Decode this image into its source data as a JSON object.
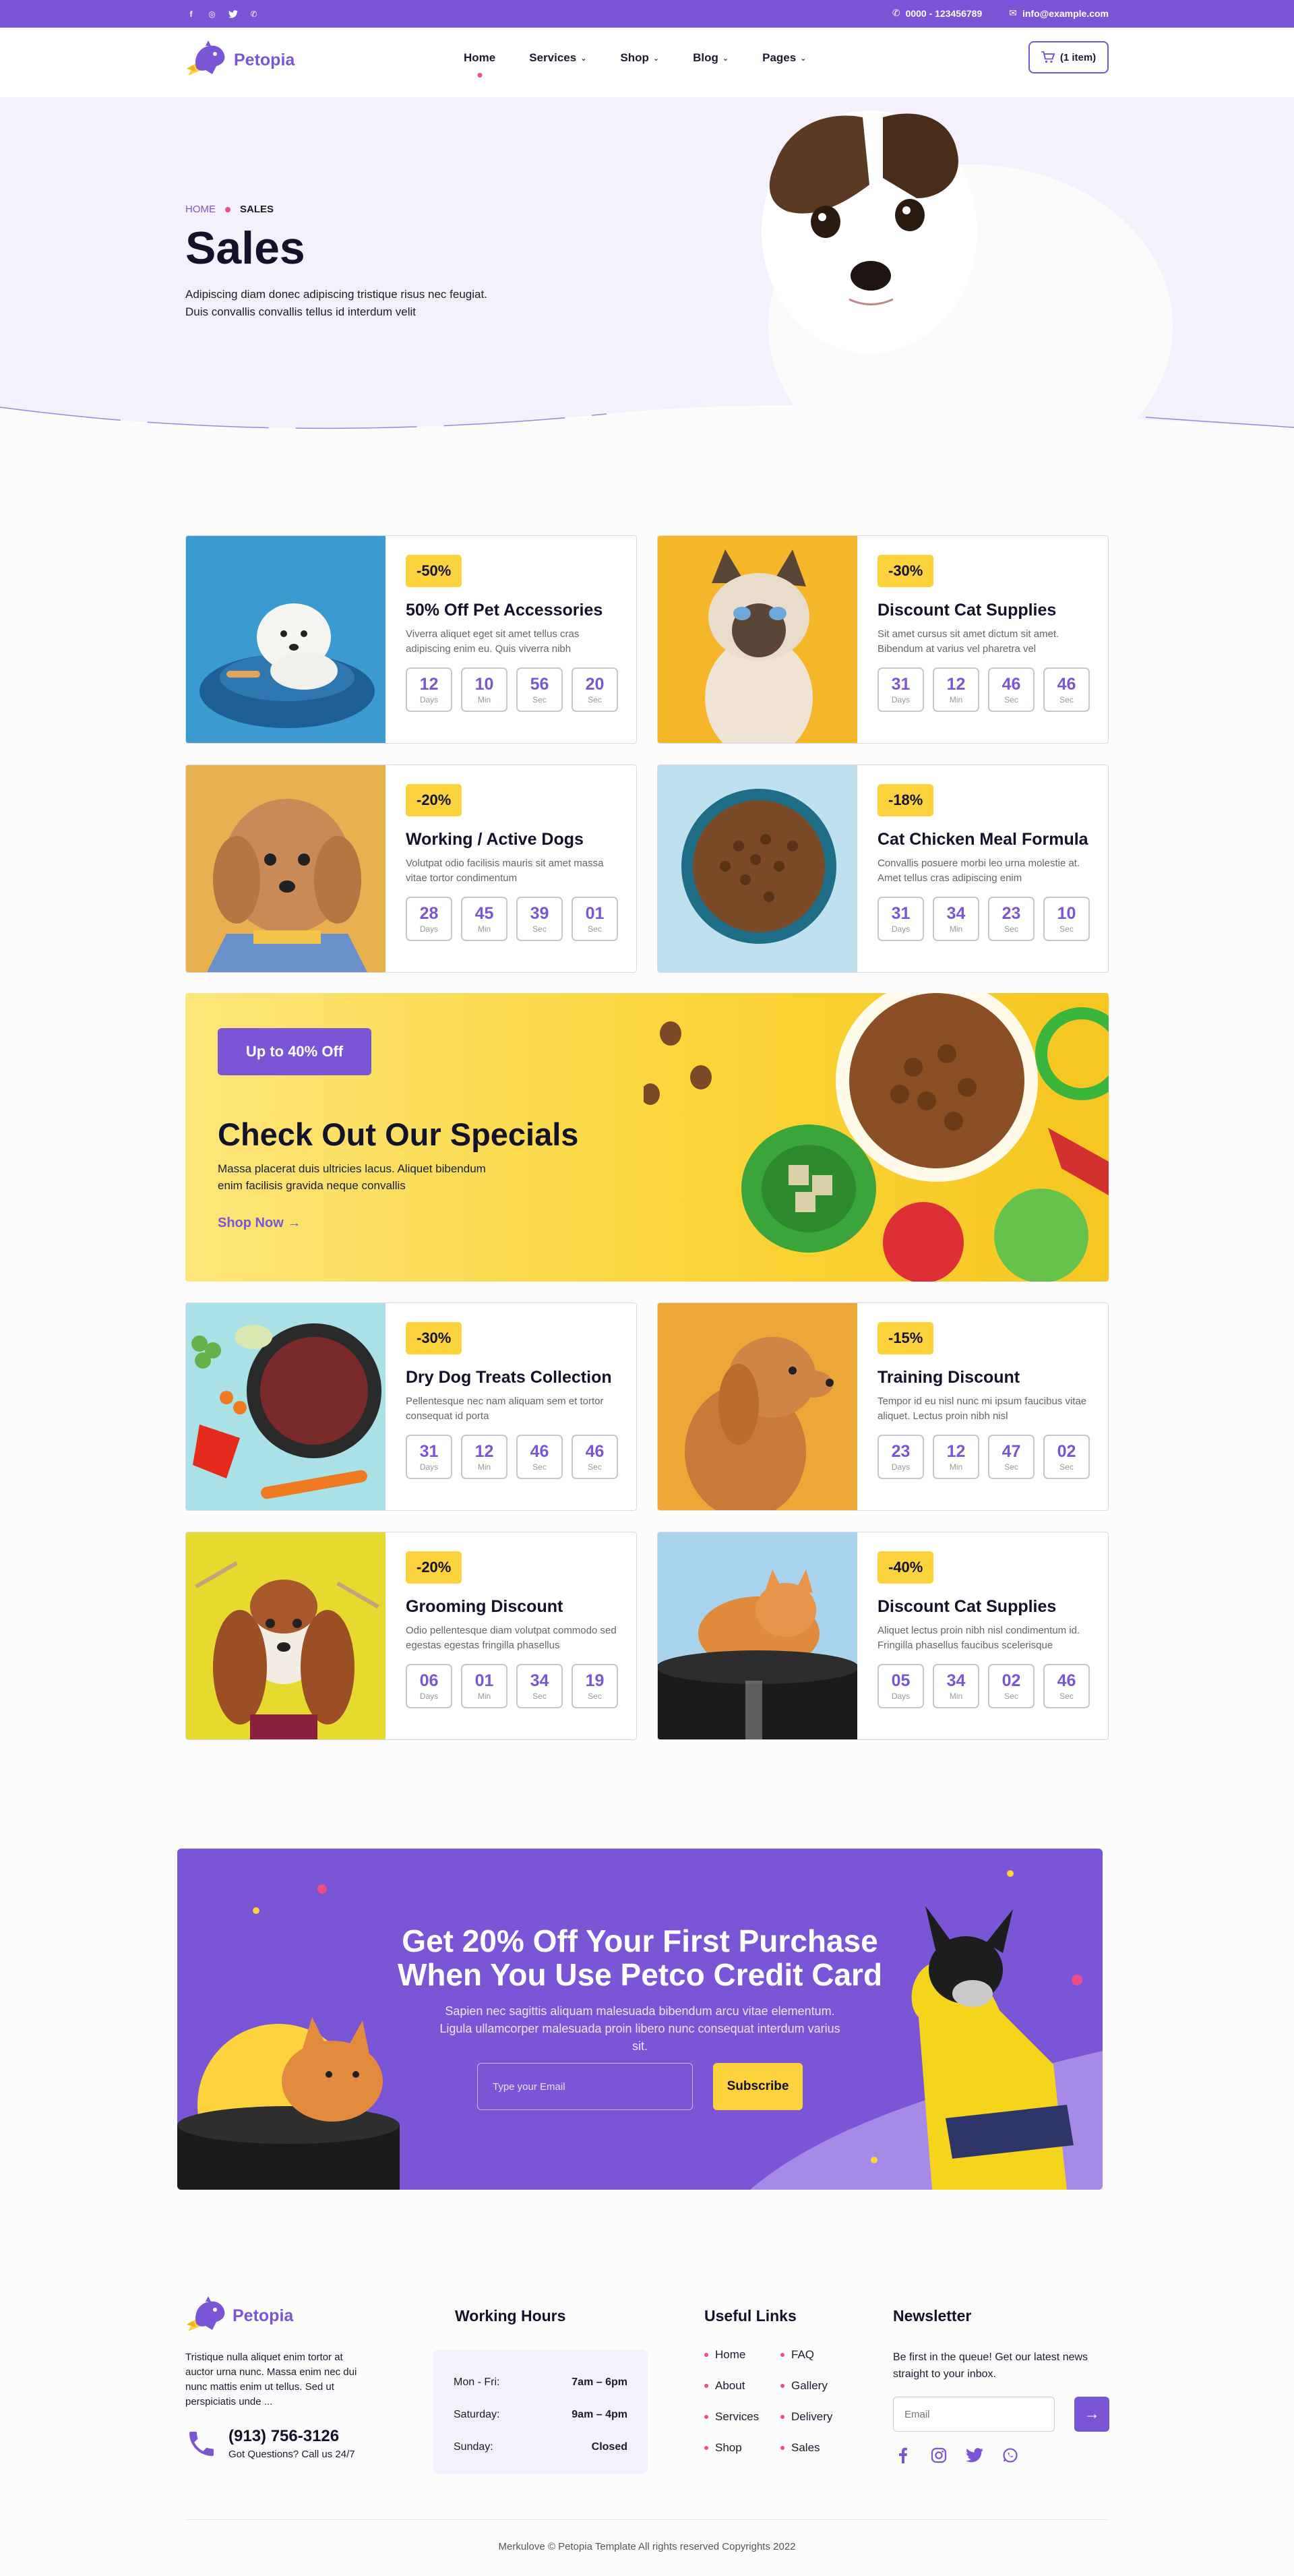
{
  "topbar": {
    "social": [
      {
        "icon": "facebook-icon",
        "glyph": "f"
      },
      {
        "icon": "instagram-icon",
        "glyph": "◎"
      },
      {
        "icon": "twitter-icon",
        "glyph": "t"
      },
      {
        "icon": "whatsapp-icon",
        "glyph": "✆"
      }
    ],
    "phone": "0000 - 123456789",
    "email": "info@example.com"
  },
  "header": {
    "brand": "Petopia",
    "nav": [
      {
        "label": "Home",
        "active": true
      },
      {
        "label": "Services",
        "dropdown": true
      },
      {
        "label": "Shop",
        "dropdown": true
      },
      {
        "label": "Blog",
        "dropdown": true
      },
      {
        "label": "Pages",
        "dropdown": true
      }
    ],
    "cart_label": "(1 item)"
  },
  "hero": {
    "crumb_home": "HOME",
    "crumb_current": "SALES",
    "title": "Sales",
    "subtitle": "Adipiscing diam donec adipiscing tristique risus nec feugiat. Duis convallis convallis tellus id interdum velit"
  },
  "timer_labels": {
    "d": "Days",
    "m": "Min",
    "s1": "Sec",
    "s2": "Sec"
  },
  "sales": [
    {
      "badge": "-50%",
      "title": "50% Off Pet Accessories",
      "desc": "Viverra aliquet eget sit amet tellus cras adipiscing enim eu. Quis viverra nibh",
      "timer": [
        "12",
        "10",
        "56",
        "20"
      ],
      "image": "white-dog-bed"
    },
    {
      "badge": "-30%",
      "title": "Discount Cat Supplies",
      "desc": "Sit amet cursus sit amet dictum sit amet. Bibendum at varius vel pharetra vel",
      "timer": [
        "31",
        "12",
        "46",
        "46"
      ],
      "image": "siamese-cat"
    },
    {
      "badge": "-20%",
      "title": "Working / Active Dogs",
      "desc": "Volutpat odio facilisis mauris sit amet massa vitae tortor condimentum",
      "timer": [
        "28",
        "45",
        "39",
        "01"
      ],
      "image": "fluffy-puppy"
    },
    {
      "badge": "-18%",
      "title": "Cat Chicken Meal Formula",
      "desc": "Convallis posuere morbi leo urna molestie at. Amet tellus cras adipiscing enim",
      "timer": [
        "31",
        "34",
        "23",
        "10"
      ],
      "image": "kibble-bowl"
    },
    {
      "badge": "-30%",
      "title": "Dry Dog Treats Collection",
      "desc": "Pellentesque nec nam aliquam sem et tortor consequat id porta",
      "timer": [
        "31",
        "12",
        "46",
        "46"
      ],
      "image": "dog-food-veg"
    },
    {
      "badge": "-15%",
      "title": "Training Discount",
      "desc": "Tempor id eu nisl nunc mi ipsum faucibus vitae aliquet. Lectus proin nibh nisl",
      "timer": [
        "23",
        "12",
        "47",
        "02"
      ],
      "image": "poodle"
    },
    {
      "badge": "-20%",
      "title": "Grooming Discount",
      "desc": "Odio pellentesque diam volutpat commodo sed egestas egestas fringilla phasellus",
      "timer": [
        "06",
        "01",
        "34",
        "19"
      ],
      "image": "spaniel-grooming"
    },
    {
      "badge": "-40%",
      "title": "Discount Cat Supplies",
      "desc": "Aliquet lectus proin nibh nisl condimentum id. Fringilla phasellus faucibus scelerisque",
      "timer": [
        "05",
        "34",
        "02",
        "46"
      ],
      "image": "cat-in-bowl"
    }
  ],
  "specials": {
    "button": "Up to 40% Off",
    "title": "Check Out Our Specials",
    "desc": "Massa placerat duis ultricies lacus. Aliquet bibendum enim facilisis gravida neque convallis",
    "link": "Shop Now"
  },
  "promo": {
    "title_line1": "Get 20% Off Your First Purchase",
    "title_line2": "When You Use Petco Credit Card",
    "subtitle": "Sapien nec sagittis aliquam malesuada bibendum arcu vitae elementum. Ligula ullamcorper malesuada proin libero nunc consequat interdum varius sit.",
    "input_placeholder": "Type your Email",
    "button": "Subscribe"
  },
  "footer": {
    "brand": "Petopia",
    "about": "Tristique nulla aliquet enim tortor at auctor urna nunc. Massa enim nec dui nunc mattis enim ut tellus. Sed ut perspiciatis unde ...",
    "phone": "(913) 756-3126",
    "phone_note": "Got Questions? Call us 24/7",
    "hours_title": "Working Hours",
    "hours": [
      {
        "day": "Mon - Fri:",
        "time": "7am – 6pm"
      },
      {
        "day": "Saturday:",
        "time": "9am – 4pm"
      },
      {
        "day": "Sunday:",
        "time": "Closed"
      }
    ],
    "links_title": "Useful Links",
    "links": [
      "Home",
      "FAQ",
      "About",
      "Gallery",
      "Services",
      "Delivery",
      "Shop",
      "Sales"
    ],
    "newsletter_title": "Newsletter",
    "newsletter_text": "Be first in the queue! Get our latest news straight to your inbox.",
    "newsletter_placeholder": "Email",
    "social": [
      "facebook-icon",
      "instagram-icon",
      "twitter-icon",
      "whatsapp-icon"
    ],
    "copyright": "Merkulove © Petopia Template All rights reserved Copyrights 2022"
  },
  "colors": {
    "primary": "#7a55d6",
    "accent_yellow": "#fcd33c",
    "pink": "#ec4e8a"
  }
}
